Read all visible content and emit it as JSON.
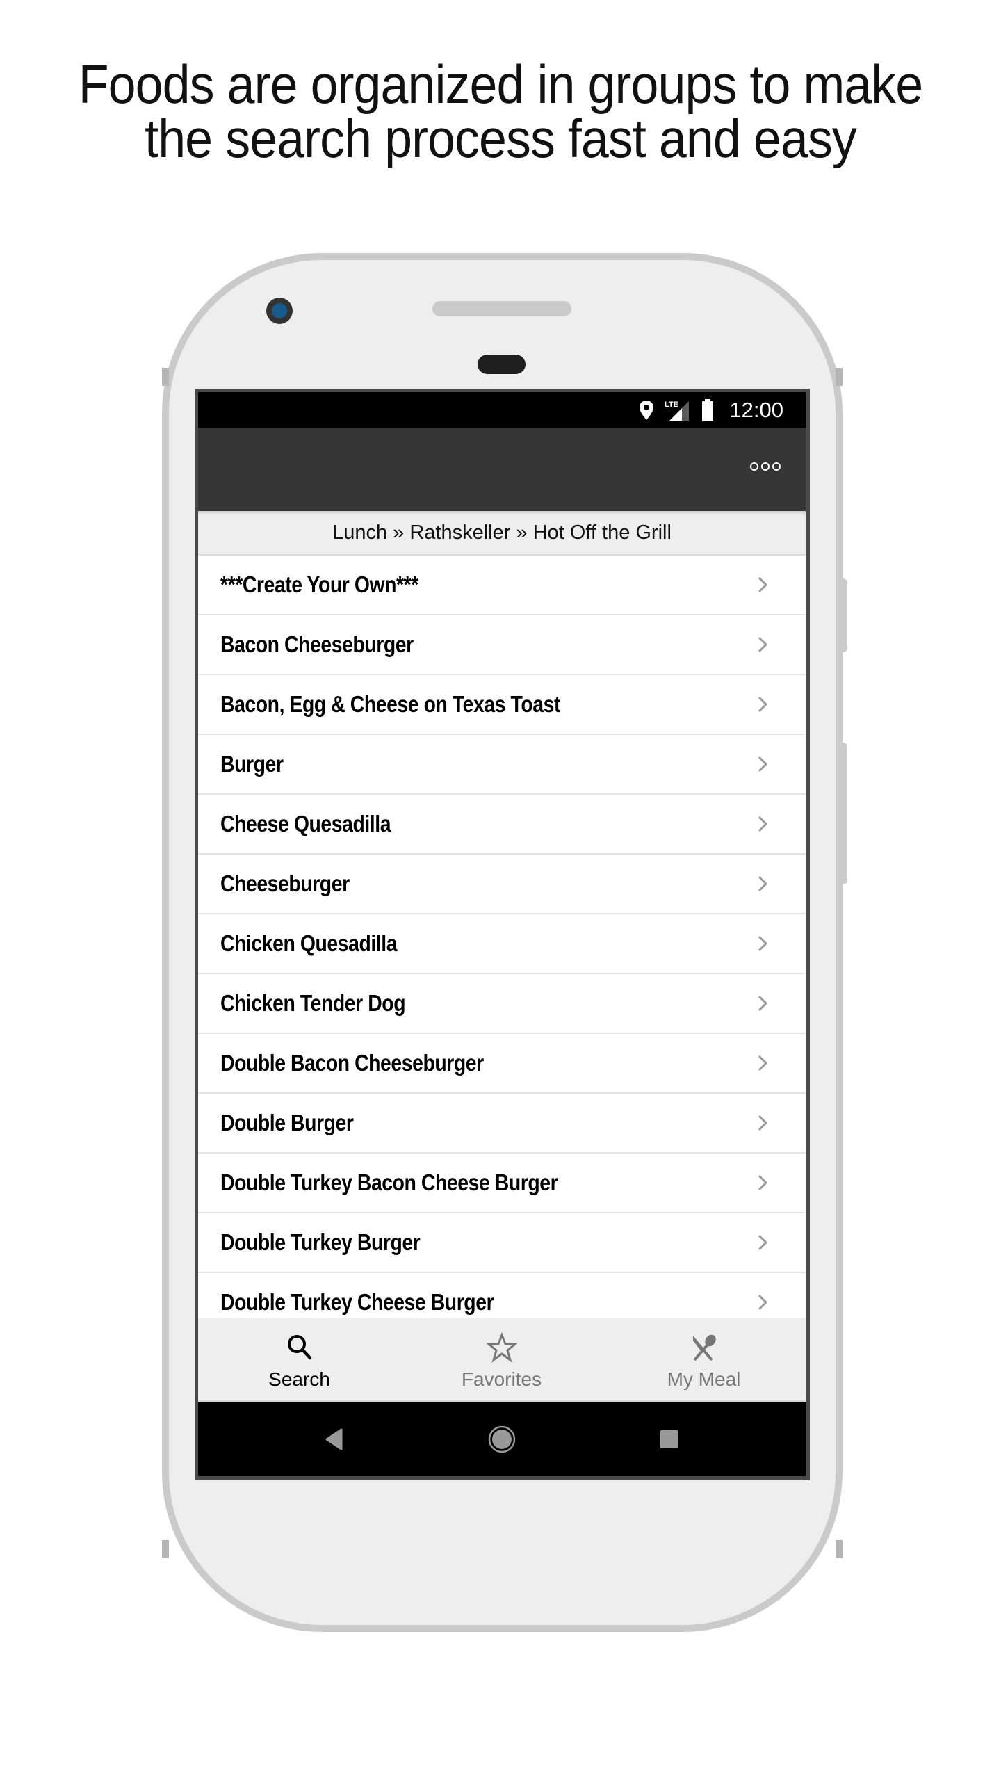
{
  "headline": {
    "line1": "Foods are organized in groups to make",
    "line2": "the search process fast and easy"
  },
  "status_bar": {
    "time": "12:00",
    "icons": [
      "location-icon",
      "lte-signal-icon",
      "battery-icon"
    ],
    "network_label": "LTE"
  },
  "toolbar": {
    "overflow_icon": "more-options-icon"
  },
  "breadcrumb": {
    "text": "Lunch » Rathskeller » Hot Off the Grill",
    "parts": [
      "Lunch",
      "Rathskeller",
      "Hot Off the Grill"
    ]
  },
  "food_list": {
    "items": [
      {
        "label": "***Create Your Own***"
      },
      {
        "label": "Bacon Cheeseburger"
      },
      {
        "label": "Bacon, Egg & Cheese on Texas Toast"
      },
      {
        "label": "Burger"
      },
      {
        "label": "Cheese Quesadilla"
      },
      {
        "label": "Cheeseburger"
      },
      {
        "label": "Chicken Quesadilla"
      },
      {
        "label": "Chicken Tender Dog"
      },
      {
        "label": "Double Bacon Cheeseburger"
      },
      {
        "label": "Double Burger"
      },
      {
        "label": "Double Turkey Bacon Cheese Burger"
      },
      {
        "label": "Double Turkey Burger"
      },
      {
        "label": "Double Turkey Cheese Burger"
      }
    ]
  },
  "bottom_nav": {
    "items": [
      {
        "label": "Search",
        "icon": "search-icon",
        "active": true
      },
      {
        "label": "Favorites",
        "icon": "star-icon",
        "active": false
      },
      {
        "label": "My Meal",
        "icon": "utensils-icon",
        "active": false
      }
    ]
  },
  "system_nav": {
    "buttons": [
      "back",
      "home",
      "recents"
    ]
  },
  "colors": {
    "toolbar": "#363636",
    "status_bar": "#000000",
    "breadcrumb_bg": "#eeeeee",
    "active_nav": "#000000",
    "inactive_nav": "#777777",
    "chevron": "#9a9a9a",
    "phone_body": "#eeeeee",
    "phone_frame": "#cacaca",
    "camera_lens": "#185a8c"
  }
}
